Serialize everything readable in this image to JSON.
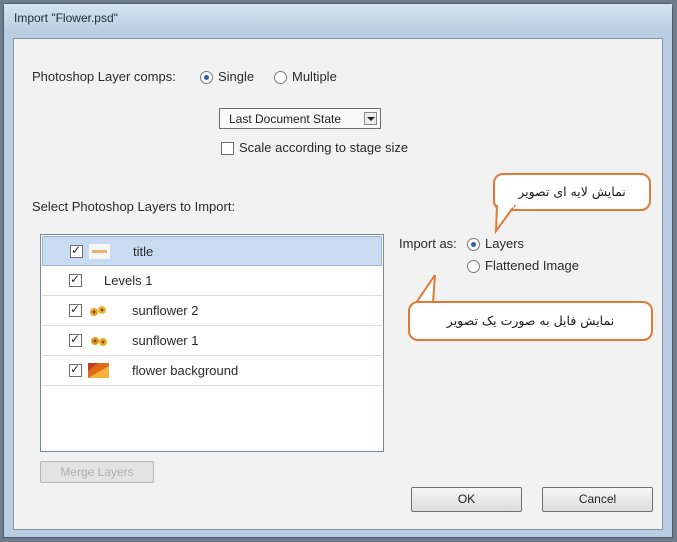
{
  "window": {
    "title": "Import \"Flower.psd\""
  },
  "layer_comps": {
    "label": "Photoshop Layer comps:",
    "option_single": "Single",
    "option_multiple": "Multiple",
    "selected": "Single",
    "dropdown_value": "Last Document State",
    "scale_label": "Scale according to stage size",
    "scale_checked": false
  },
  "layers_section": {
    "label": "Select Photoshop Layers to Import:",
    "layers": [
      {
        "name": "title",
        "checked": true,
        "selected": true,
        "thumb": "title-thumbnail"
      },
      {
        "name": "Levels 1",
        "checked": true,
        "selected": false,
        "thumb": "none"
      },
      {
        "name": "sunflower 2",
        "checked": true,
        "selected": false,
        "thumb": "sunflower-thumbnail"
      },
      {
        "name": "sunflower 1",
        "checked": true,
        "selected": false,
        "thumb": "sunflower-thumbnail"
      },
      {
        "name": "flower background",
        "checked": true,
        "selected": false,
        "thumb": "background-thumbnail"
      }
    ],
    "below_list_button": "Merge Layers"
  },
  "import_as": {
    "label": "Import as:",
    "option_layers": "Layers",
    "option_flattened": "Flattened Image",
    "selected": "Layers"
  },
  "callouts": {
    "layers_note": "نمایش لایه ای تصویر",
    "flattened_note": "نمایش فایل به صورت یک تصویر"
  },
  "buttons": {
    "ok": "OK",
    "cancel": "Cancel"
  },
  "colors": {
    "callout_border": "#e07a34",
    "selection": "#c8dbf0",
    "window_frame": "#b9cde3"
  }
}
